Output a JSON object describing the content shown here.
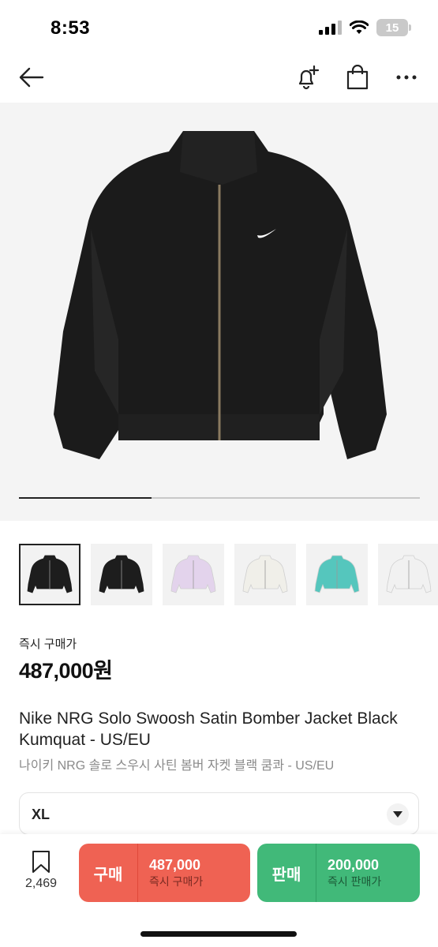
{
  "status_bar": {
    "time": "8:53",
    "battery": "15"
  },
  "header": {
    "back_icon": "arrow-left-icon",
    "notify_icon": "bell-plus-icon",
    "bag_icon": "shopping-bag-icon",
    "more_icon": "more-horizontal-icon"
  },
  "gallery": {
    "progress": 0.33,
    "thumbnails": [
      {
        "color": "#1d1d1d",
        "selected": true
      },
      {
        "color": "#1d1d1d",
        "selected": false
      },
      {
        "color": "#e3d3ec",
        "selected": false
      },
      {
        "color": "#f0efe9",
        "selected": false
      },
      {
        "color": "#55c6bd",
        "selected": false
      },
      {
        "color": "#f1f1f1",
        "selected": false
      }
    ]
  },
  "price": {
    "label": "즉시 구매가",
    "value": "487,000원"
  },
  "product": {
    "title_en": "Nike NRG Solo Swoosh Satin Bomber Jacket Black Kumquat - US/EU",
    "title_ko": "나이키 NRG 솔로 스우시 사틴 봄버 자켓 블랙 쿰콰 - US/EU"
  },
  "size_select": {
    "value": "XL"
  },
  "bottom_bar": {
    "wishlist_count": "2,469",
    "buy": {
      "label": "구매",
      "price": "487,000",
      "sub": "즉시 구매가",
      "color": "#ef6253"
    },
    "sell": {
      "label": "판매",
      "price": "200,000",
      "sub": "즉시 판매가",
      "color": "#41b979"
    }
  }
}
